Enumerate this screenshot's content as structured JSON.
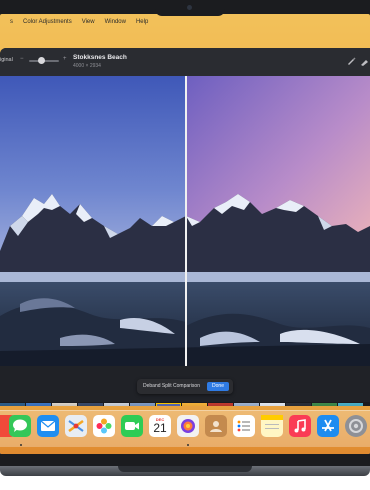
{
  "menubar": {
    "items": [
      "Color Adjustments",
      "View",
      "Window",
      "Help"
    ],
    "partial_left": "s"
  },
  "toolbar": {
    "original_label": "iginal",
    "minus": "−",
    "plus": "+",
    "photo_title": "Stokksnes Beach",
    "photo_dims": "4000 × 2934"
  },
  "hud": {
    "label": "Deband Split Comparison",
    "done": "Done"
  },
  "dock": {
    "calendar_month": "DEC",
    "calendar_day": "21"
  },
  "colors": {
    "accent": "#2f7be4",
    "selection": "#f5c400",
    "window_bg": "#202227"
  }
}
